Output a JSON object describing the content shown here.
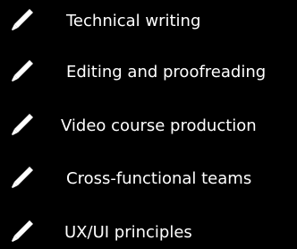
{
  "skills": [
    {
      "label": "Technical writing",
      "icon": "pencil-icon"
    },
    {
      "label": "Editing and proofreading",
      "icon": "pencil-icon"
    },
    {
      "label": "Video course production",
      "icon": "pencil-icon"
    },
    {
      "label": "Cross-functional teams",
      "icon": "pencil-icon"
    },
    {
      "label": "UX/UI principles",
      "icon": "pencil-icon"
    }
  ],
  "colors": {
    "background": "#000000",
    "text": "#ffffff",
    "icon": "#ffffff"
  }
}
